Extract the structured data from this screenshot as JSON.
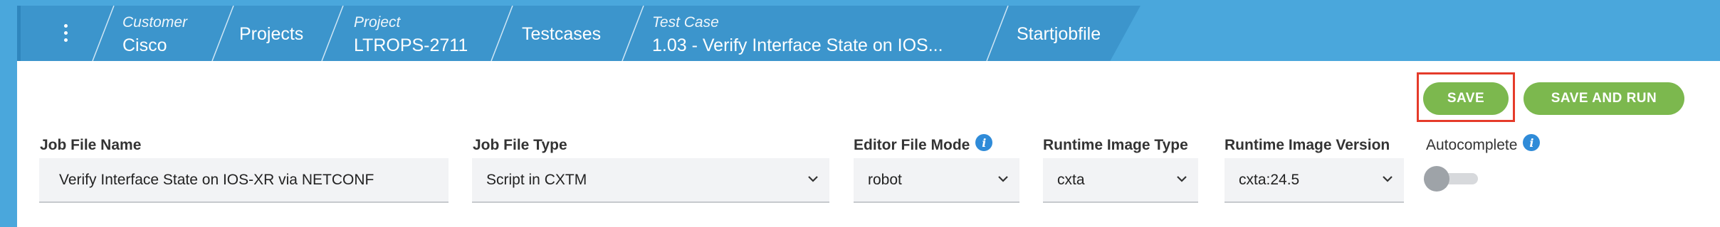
{
  "breadcrumb": {
    "customer": {
      "key": "Customer",
      "value": "Cisco"
    },
    "projects": "Projects",
    "project": {
      "key": "Project",
      "value": "LTROPS-2711"
    },
    "testcases": "Testcases",
    "test_case": {
      "key": "Test Case",
      "value": "1.03 - Verify Interface State on IOS..."
    },
    "startjobfile": "Startjobfile"
  },
  "actions": {
    "save": "SAVE",
    "save_and_run": "SAVE AND RUN"
  },
  "form": {
    "job_file_name": {
      "label": "Job File Name",
      "value": "Verify Interface State on IOS-XR via NETCONF"
    },
    "job_file_type": {
      "label": "Job File Type",
      "value": "Script in CXTM"
    },
    "editor_file_mode": {
      "label": "Editor File Mode",
      "value": "robot"
    },
    "runtime_image_type": {
      "label": "Runtime Image Type",
      "value": "cxta"
    },
    "runtime_image_version": {
      "label": "Runtime Image Version",
      "value": "cxta:24.5"
    },
    "autocomplete": {
      "label": "Autocomplete",
      "enabled": false
    }
  },
  "icons": {
    "info": "i",
    "kebab": "more-vertical-icon",
    "dropdown": "chevron-down-icon"
  },
  "colors": {
    "header_blue": "#4aa7dc",
    "crumb_blue": "#3c95cc",
    "button_green": "#7cb84e",
    "highlight_red": "#e53b2a",
    "info_blue": "#2f8bd8"
  }
}
